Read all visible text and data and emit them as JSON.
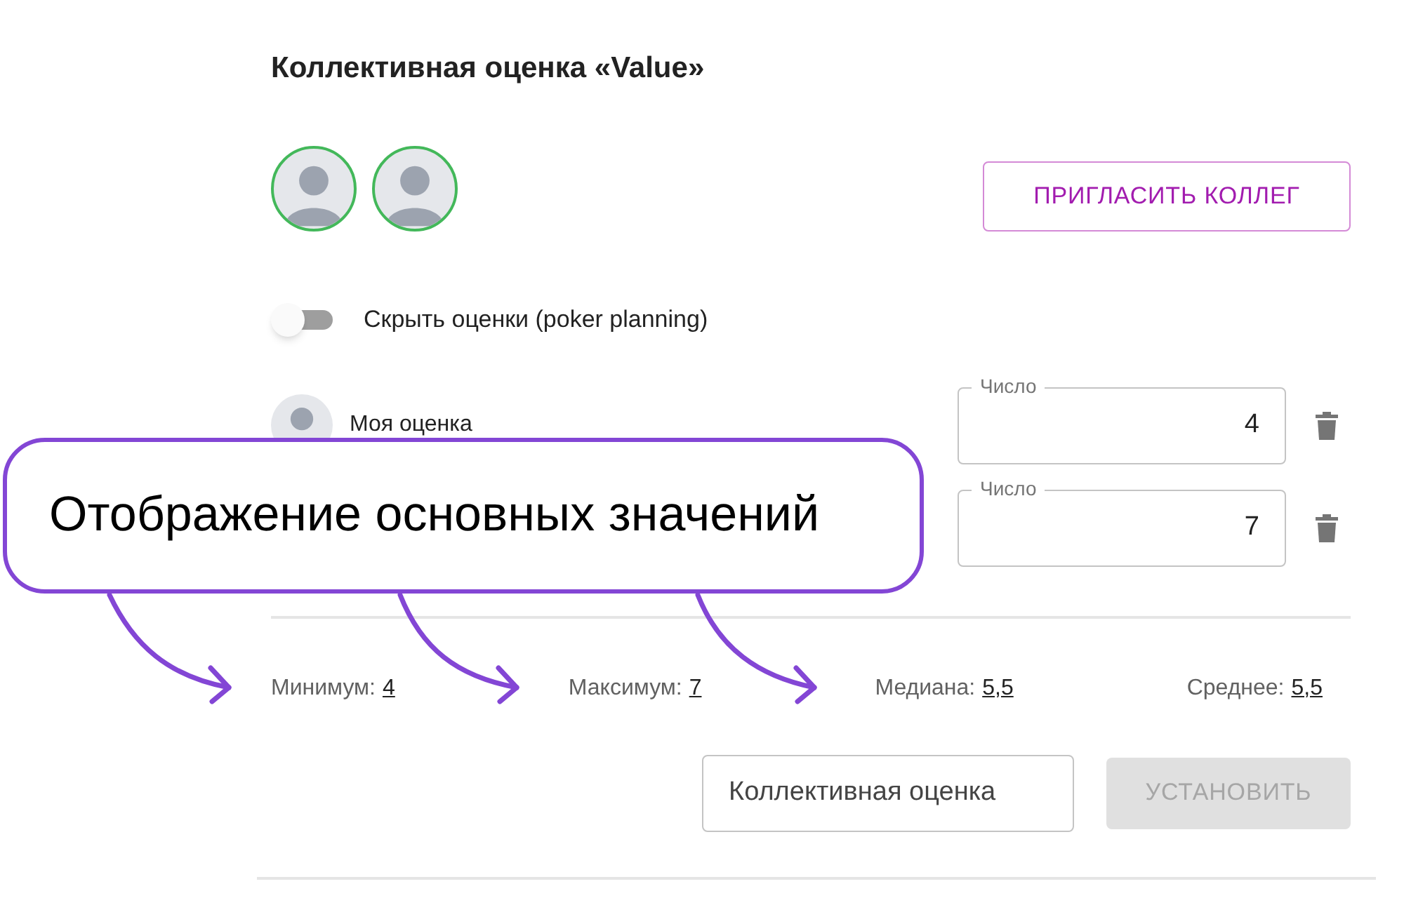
{
  "title": "Коллективная оценка «Value»",
  "participants": [
    {
      "online": true
    },
    {
      "online": true
    }
  ],
  "invite_button": "ПРИГЛАСИТЬ КОЛЛЕГ",
  "hide_toggle": {
    "label": "Скрыть оценки (poker planning)",
    "on": false
  },
  "estimates": [
    {
      "name": "Моя оценка",
      "field_label": "Число",
      "value": "4"
    },
    {
      "field_label": "Число",
      "value": "7"
    }
  ],
  "stats": [
    {
      "label": "Минимум:",
      "value": "4"
    },
    {
      "label": "Максимум:",
      "value": "7"
    },
    {
      "label": "Медиана:",
      "value": "5,5"
    },
    {
      "label": "Среднее:",
      "value": "5,5"
    }
  ],
  "collective_field": {
    "value": "Коллективная оценка"
  },
  "set_button": {
    "label": "УСТАНОВИТЬ",
    "disabled": true
  },
  "callout": "Отображение основных значений"
}
